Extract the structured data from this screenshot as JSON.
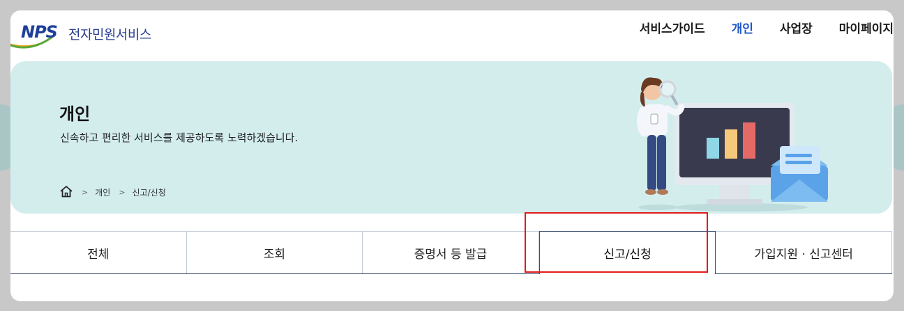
{
  "header": {
    "logo_text": "NPS",
    "site_title": "전자민원서비스",
    "nav": [
      {
        "label": "서비스가이드",
        "active": false
      },
      {
        "label": "개인",
        "active": true
      },
      {
        "label": "사업장",
        "active": false
      },
      {
        "label": "마이페이지",
        "active": false
      }
    ]
  },
  "hero": {
    "title": "개인",
    "description": "신속하고 편리한 서비스를 제공하도록 노력하겠습니다.",
    "breadcrumb": {
      "home_icon": "home-icon",
      "items": [
        "개인",
        "신고/신청"
      ]
    }
  },
  "tabs": [
    {
      "label": "전체",
      "active": false
    },
    {
      "label": "조회",
      "active": false
    },
    {
      "label": "증명서 등 발급",
      "active": false
    },
    {
      "label": "신고/신청",
      "active": true
    },
    {
      "label": "가입지원 · 신고센터",
      "active": false
    }
  ],
  "colors": {
    "brand_blue": "#1e3f9a",
    "active_nav": "#1e58c9",
    "hero_bg": "#d3eded",
    "highlight": "#e41919"
  }
}
